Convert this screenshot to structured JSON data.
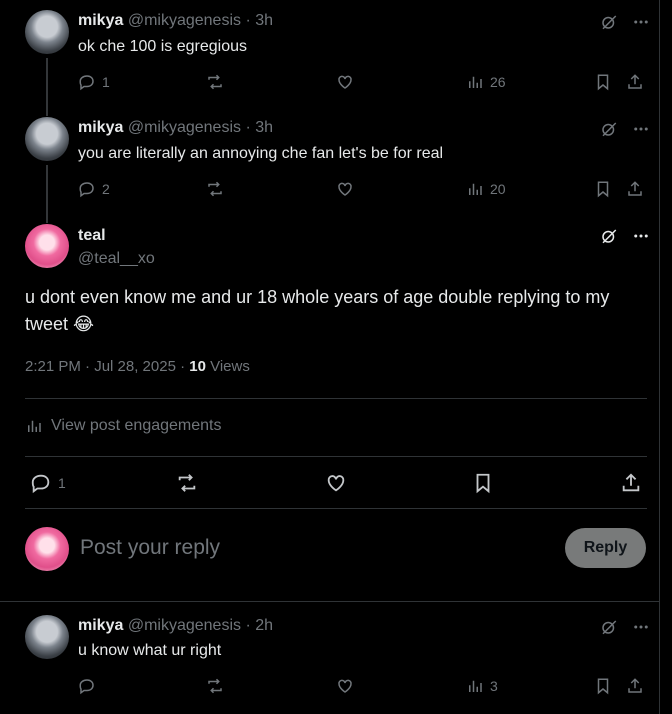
{
  "replies_above": [
    {
      "name": "mikya",
      "handle": "@mikyagenesis",
      "time": "3h",
      "text": "ok che 100 is egregious",
      "reply_count": "1",
      "views": "26"
    },
    {
      "name": "mikya",
      "handle": "@mikyagenesis",
      "time": "3h",
      "text": "you are literally an annoying che fan let's be for real",
      "reply_count": "2",
      "views": "20"
    }
  ],
  "main_post": {
    "name": "teal",
    "handle": "@teal__xo",
    "text": "u dont even know me and ur 18 whole years of age double replying to my tweet 😂",
    "timestamp": "2:21 PM · Jul 28, 2025 · ",
    "views_count": "10",
    "views_label": " Views",
    "engagements_label": "View post engagements",
    "reply_count": "1"
  },
  "composer": {
    "placeholder": "Post your reply",
    "reply_button": "Reply"
  },
  "reply_below": {
    "name": "mikya",
    "handle": "@mikyagenesis",
    "time": "2h",
    "text": "u know what ur right",
    "views": "3"
  },
  "separator": " · ",
  "colors": {
    "muted": "#71767b",
    "text": "#e7e9ea",
    "background": "#000000"
  }
}
